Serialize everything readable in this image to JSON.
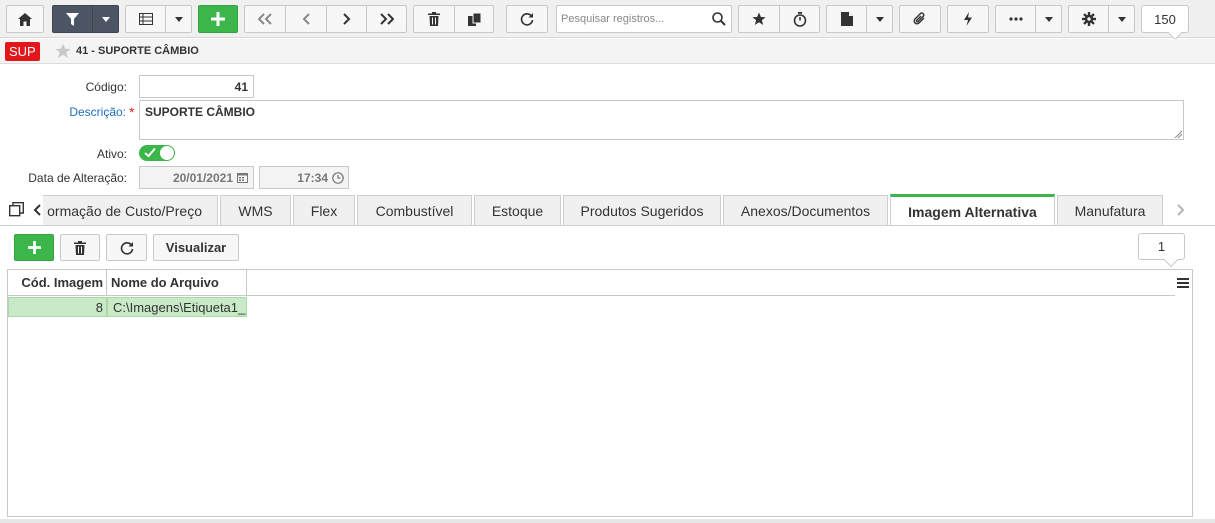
{
  "toolbar": {
    "search_placeholder": "Pesquisar registros...",
    "record_count": "150"
  },
  "header": {
    "badge": "SUP",
    "title": "41 - SUPORTE CÂMBIO"
  },
  "form": {
    "codigo_label": "Código:",
    "codigo_value": "41",
    "descricao_label": "Descrição:",
    "descricao_value": "SUPORTE CÂMBIO",
    "ativo_label": "Ativo:",
    "ativo_on": true,
    "data_alteracao_label": "Data de Alteração:",
    "data_alteracao_date": "20/01/2021",
    "data_alteracao_time": "17:34"
  },
  "tabs": [
    {
      "label": "ormação de Custo/Preço",
      "active": false
    },
    {
      "label": "WMS",
      "active": false
    },
    {
      "label": "Flex",
      "active": false
    },
    {
      "label": "Combustível",
      "active": false
    },
    {
      "label": "Estoque",
      "active": false
    },
    {
      "label": "Produtos Sugeridos",
      "active": false
    },
    {
      "label": "Anexos/Documentos",
      "active": false
    },
    {
      "label": "Imagem Alternativa",
      "active": true
    },
    {
      "label": "Manufatura",
      "active": false
    }
  ],
  "panel": {
    "visualizar_label": "Visualizar",
    "row_count": "1",
    "grid": {
      "columns": [
        "Cód. Imagem",
        "Nome do Arquivo"
      ],
      "rows": [
        {
          "cod_imagem": "8",
          "nome_arquivo": "C:\\Imagens\\Etiqueta1_"
        }
      ]
    }
  },
  "colors": {
    "accent_green": "#3cb54a",
    "badge_red": "#e3161b",
    "dark_button": "#4b5563",
    "selected_row": "#c8eac7",
    "link_blue": "#1a6fc4"
  },
  "icons": {
    "toolbar": [
      "home-icon",
      "filter-icon",
      "list-view-icon",
      "add-icon",
      "first-record-icon",
      "previous-record-icon",
      "next-record-icon",
      "last-record-icon",
      "delete-icon",
      "copy-icon",
      "refresh-icon",
      "search-icon",
      "star-icon",
      "stopwatch-icon",
      "document-icon",
      "attachment-icon",
      "lightning-icon",
      "more-icon",
      "settings-icon"
    ]
  }
}
